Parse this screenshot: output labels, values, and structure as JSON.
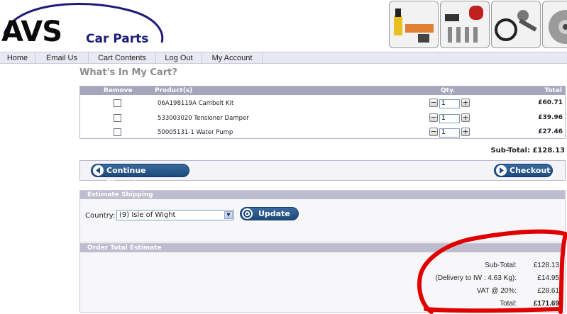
{
  "logo": {
    "avs": "AVS",
    "car_parts": "Car Parts"
  },
  "nav": [
    "Home",
    "Email Us",
    "Cart Contents",
    "Log Out",
    "My Account"
  ],
  "page_title": "What's In My Cart?",
  "cart": {
    "headers": {
      "remove": "Remove",
      "product": "Product(s)",
      "qty": "Qty.",
      "total": "Total"
    },
    "items": [
      {
        "product": "06A198119A Cambelt Kit",
        "qty": "1",
        "total": "£60.71"
      },
      {
        "product": "533003020 Tensioner Damper",
        "qty": "1",
        "total": "£39.96"
      },
      {
        "product": "50005131-1 Water Pump",
        "qty": "1",
        "total": "£27.46"
      }
    ],
    "subtotal": "Sub-Total: £128.13"
  },
  "buttons": {
    "continue": "Continue Shopping",
    "checkout": "Checkout",
    "update": "Update"
  },
  "shipping": {
    "title": "Estimate Shipping",
    "country_label": "Country:",
    "country_value": "(9) Isle of Wight"
  },
  "order_total": {
    "title": "Order Total Estimate",
    "lines": [
      {
        "label": "Sub-Total:",
        "value": "£128.13"
      },
      {
        "label": "(Delivery to IW : 4.63 Kg):",
        "value": "£14.95"
      },
      {
        "label": "VAT @ 20%:",
        "value": "£28.61"
      },
      {
        "label": "Total:",
        "value": "£171.69"
      }
    ]
  },
  "colors": {
    "accent": "#1e4a7a",
    "header_bar": "#a5a5bd",
    "annotation": "#e00000"
  }
}
